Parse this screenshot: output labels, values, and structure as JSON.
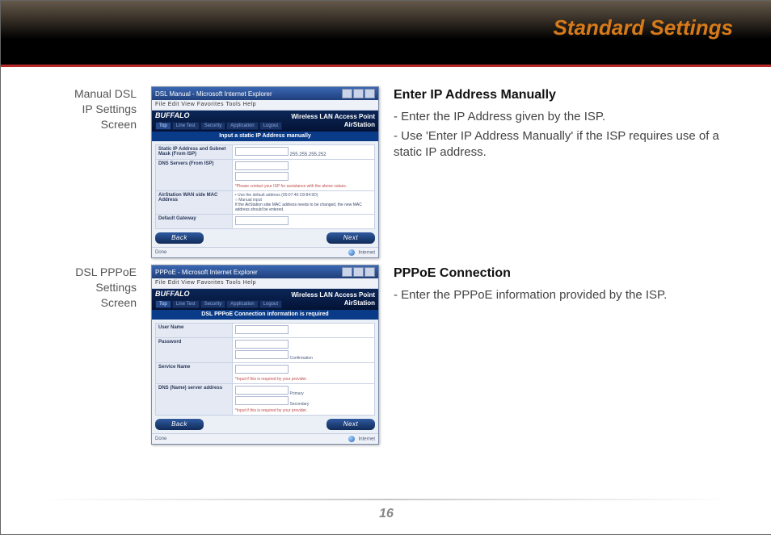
{
  "page": {
    "title": "Standard Settings",
    "number": "16"
  },
  "block1": {
    "caption_l1": "Manual DSL",
    "caption_l2": "IP Settings",
    "caption_l3": "Screen",
    "heading": "Enter IP Address Manually",
    "p1": "- Enter the IP Address given by the ISP.",
    "p2": "- Use 'Enter IP Address Manually' if the ISP requires use of a static IP address.",
    "win": {
      "title": "DSL Manual - Microsoft Internet Explorer",
      "menu": "File  Edit  View  Favorites  Tools  Help",
      "brand": "BUFFALO",
      "tagline_l1": "Wireless LAN Access Point",
      "tagline_l2": "AirStation",
      "tabs": [
        "Top",
        "Line Test",
        "Security",
        "Application",
        "Logout"
      ],
      "section": "Input a static IP Address manually",
      "rows": {
        "r1_label": "Static IP Address and Subnet Mask (From ISP)",
        "r1_val": "255.255.255.252",
        "r2_label": "DNS Servers (From ISP)",
        "r2_note": "*Please contact your ISP for assistance with the above values.",
        "r3_label": "AirStation WAN side MAC Address",
        "r3_opt1": "• Use the default address (00:07:40:C8:84:9D)",
        "r3_opt2": "○ Manual input",
        "r3_note": "If the AirStation side MAC address needs to be changed, the new MAC address should be entered.",
        "r4_label": "Default Gateway"
      },
      "back": "Back",
      "next": "Next",
      "status_left": "Done",
      "status_right": "Internet"
    }
  },
  "block2": {
    "caption_l1": "DSL PPPoE",
    "caption_l2": "Settings",
    "caption_l3": "Screen",
    "heading": "PPPoE Connection",
    "p1": "- Enter the PPPoE information provided by the ISP.",
    "win": {
      "title": "PPPoE - Microsoft Internet Explorer",
      "menu": "File  Edit  View  Favorites  Tools  Help",
      "brand": "BUFFALO",
      "tagline_l1": "Wireless LAN Access Point",
      "tagline_l2": "AirStation",
      "tabs": [
        "Top",
        "Line Test",
        "Security",
        "Application",
        "Logout"
      ],
      "section": "DSL PPPoE Connection information is required",
      "rows": {
        "r1_label": "User Name",
        "r2_label": "Password",
        "r2_hint": "Confirmation",
        "r3_label": "Service Name",
        "r3_note": "*Input if this is required by your provider.",
        "r4_label": "DNS (Name) server address",
        "r4_hint1": "Primary",
        "r4_hint2": "Secondary",
        "r4_note": "*Input if this is required by your provider."
      },
      "back": "Back",
      "next": "Next",
      "status_left": "Done",
      "status_right": "Internet"
    }
  }
}
